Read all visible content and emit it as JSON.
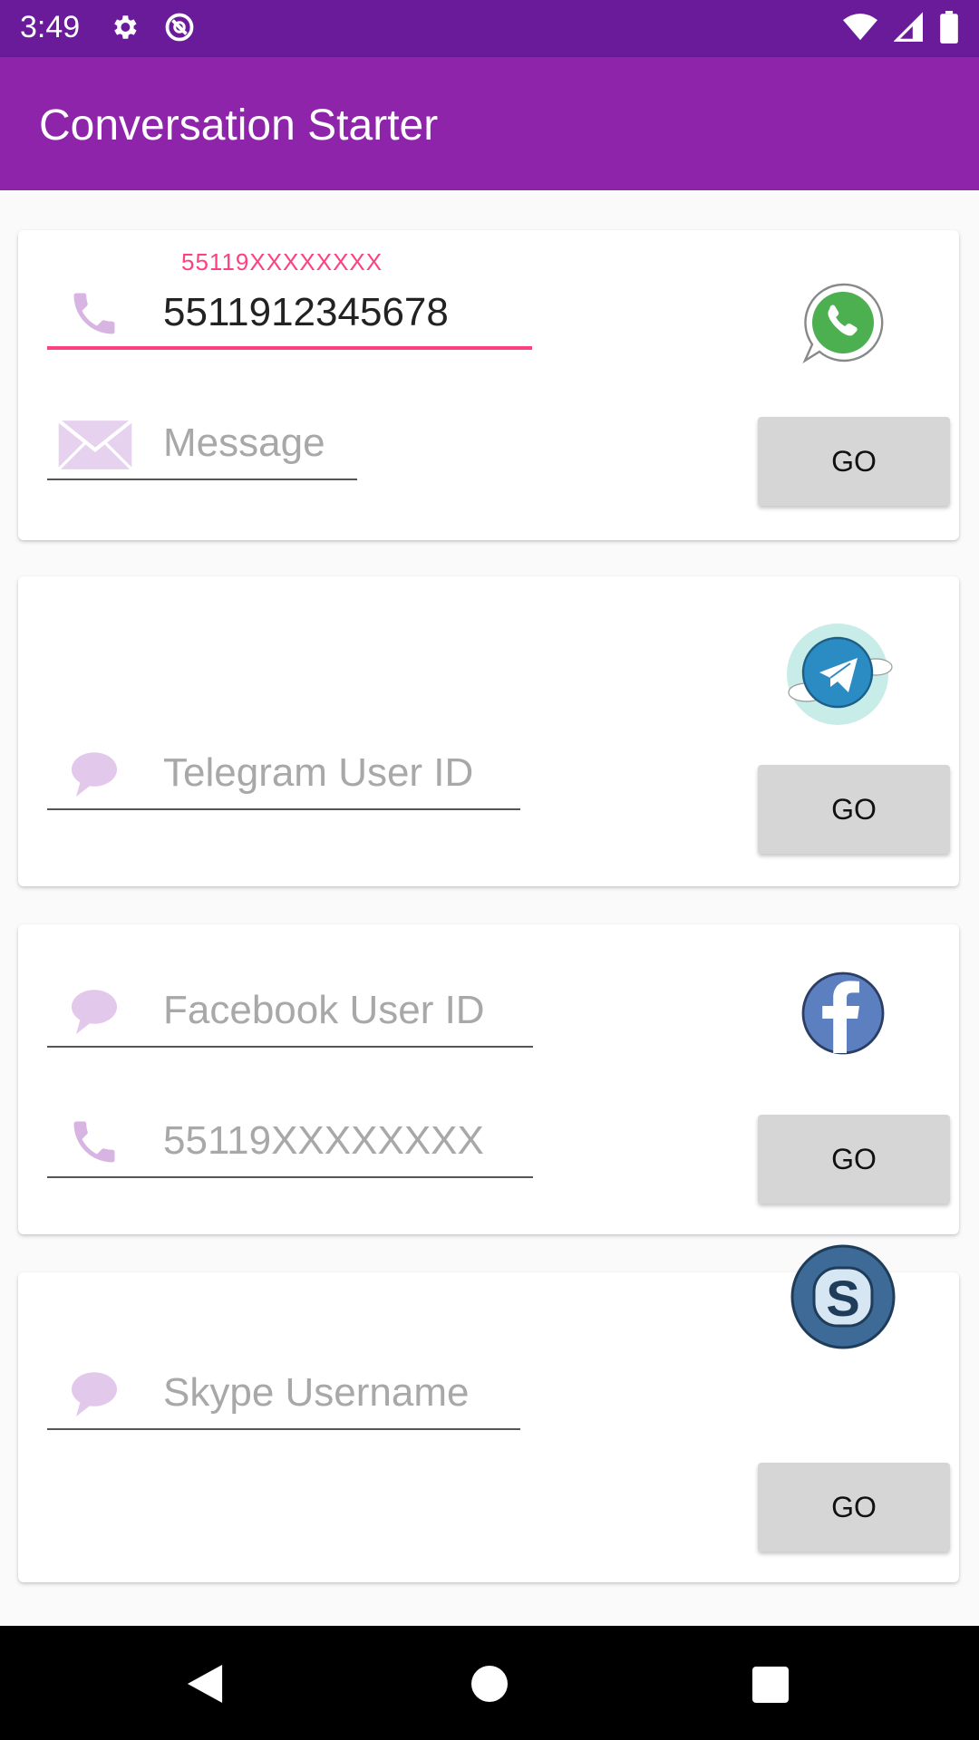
{
  "status_bar": {
    "time": "3:49",
    "icons": [
      "settings-gear-icon",
      "sync-circle-icon",
      "wifi-icon",
      "cell-signal-icon",
      "battery-icon"
    ]
  },
  "app_bar": {
    "title": "Conversation Starter",
    "color": "#8e24aa"
  },
  "cards": {
    "whatsapp": {
      "phone_label": "55119XXXXXXXX",
      "phone_value": "5511912345678",
      "message_placeholder": "Message",
      "go_label": "GO",
      "logo": "whatsapp-logo-icon"
    },
    "telegram": {
      "user_id_placeholder": "Telegram User ID",
      "go_label": "GO",
      "logo": "telegram-logo-icon"
    },
    "facebook": {
      "user_id_placeholder": "Facebook User ID",
      "phone_placeholder": "55119XXXXXXXX",
      "go_label": "GO",
      "logo": "facebook-logo-icon"
    },
    "skype": {
      "username_placeholder": "Skype Username",
      "go_label": "GO",
      "logo": "skype-logo-icon"
    }
  },
  "nav_bar": {
    "buttons": [
      "back-triangle-icon",
      "home-circle-icon",
      "recents-square-icon"
    ]
  },
  "colors": {
    "accent": "#ff4081",
    "icon_tint": "#d8b4e2",
    "button_bg": "#d6d6d6"
  }
}
